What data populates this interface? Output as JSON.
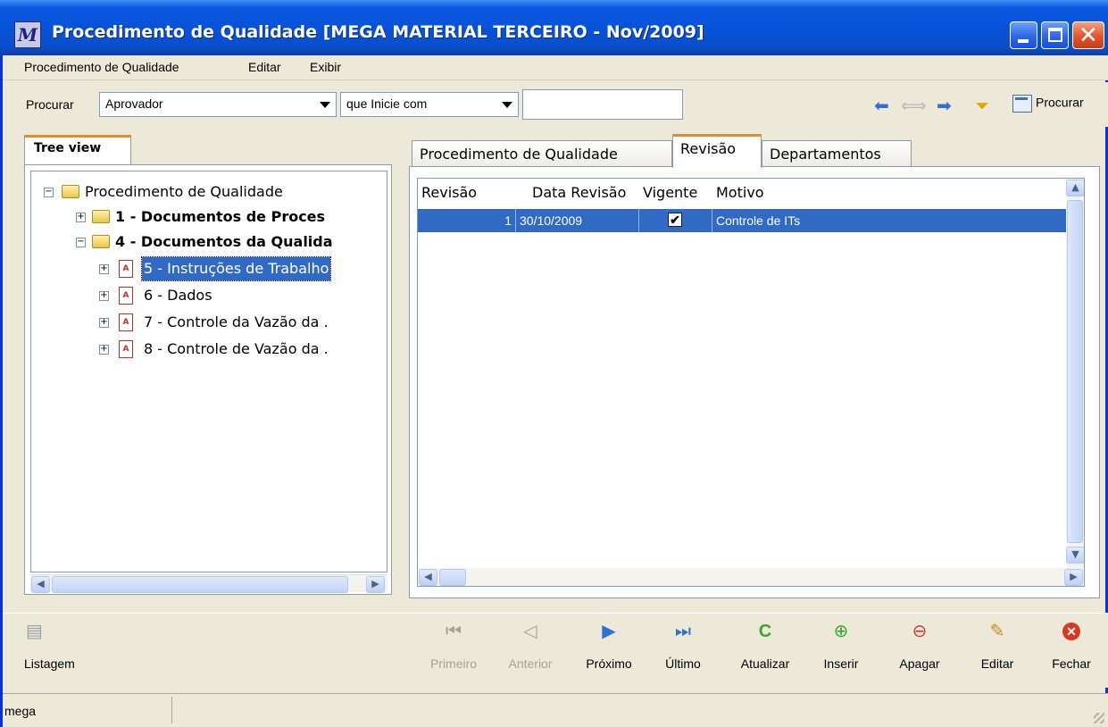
{
  "window": {
    "title": "Procedimento de Qualidade [MEGA MATERIAL TERCEIRO - Nov/2009]",
    "logo": "M"
  },
  "menu": [
    "Procedimento de Qualidade",
    "Editar",
    "Exibir"
  ],
  "search": {
    "label": "Procurar",
    "field": "Aprovador",
    "operator": "que Inicie com",
    "value": "",
    "button": "Procurar"
  },
  "left_panel": {
    "tab": "Tree view",
    "tree": {
      "root": "Procedimento de Qualidade",
      "n1": "1 - Documentos de Proces",
      "n4": "4 - Documentos da Qualida",
      "n5": "5 - Instruções de Trabalho",
      "n6": "6 - Dados",
      "n7": "7 - Controle da Vazão da .",
      "n8": "8 - Controle de Vazão da ."
    }
  },
  "right_panel": {
    "tabs": [
      "Procedimento de Qualidade",
      "Revisão",
      "Departamentos"
    ],
    "active_tab": "Revisão",
    "columns": [
      "Revisão",
      "Data Revisão",
      "Vigente",
      "Motivo"
    ],
    "rows": [
      {
        "revisao": "1",
        "data": "30/10/2009",
        "vigente": true,
        "motivo": "Controle de ITs"
      }
    ]
  },
  "toolbar": {
    "listagem": "Listagem",
    "primeiro": "Primeiro",
    "anterior": "Anterior",
    "proximo": "Próximo",
    "ultimo": "Último",
    "atualizar": "Atualizar",
    "inserir": "Inserir",
    "apagar": "Apagar",
    "editar": "Editar",
    "fechar": "Fechar"
  },
  "status": {
    "user": "mega"
  },
  "colors": {
    "title_blue": "#0653d8",
    "selection": "#316ac5",
    "tab_accent": "#e68b2c",
    "close_red": "#e2542e"
  }
}
